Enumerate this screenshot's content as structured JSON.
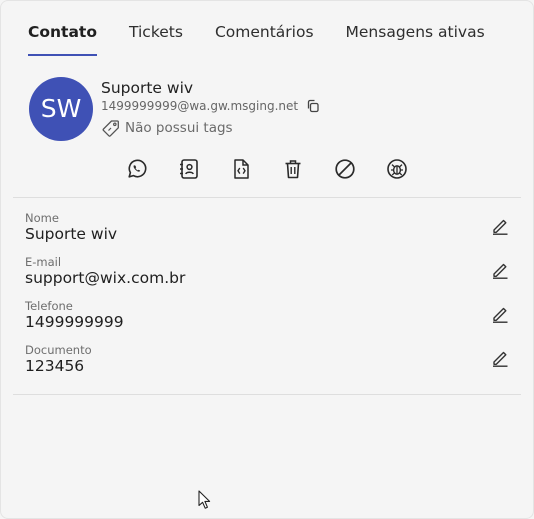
{
  "tabs": [
    {
      "label": "Contato",
      "active": true
    },
    {
      "label": "Tickets",
      "active": false
    },
    {
      "label": "Comentários",
      "active": false
    },
    {
      "label": "Mensagens ativas",
      "active": false
    }
  ],
  "contact": {
    "initials": "SW",
    "name": "Suporte wiv",
    "address": "1499999999@wa.gw.msging.net",
    "tags_label": "Não possui tags",
    "avatar_color": "#3f51b5"
  },
  "actions": [
    {
      "icon": "whatsapp-icon"
    },
    {
      "icon": "contact-card-icon"
    },
    {
      "icon": "code-file-icon"
    },
    {
      "icon": "trash-icon"
    },
    {
      "icon": "block-icon"
    },
    {
      "icon": "bug-icon"
    }
  ],
  "fields": [
    {
      "label": "Nome",
      "value": "Suporte wiv"
    },
    {
      "label": "E-mail",
      "value": "support@wix.com.br"
    },
    {
      "label": "Telefone",
      "value": "1499999999"
    },
    {
      "label": "Documento",
      "value": "123456"
    }
  ],
  "colors": {
    "accent": "#3f51b5"
  }
}
